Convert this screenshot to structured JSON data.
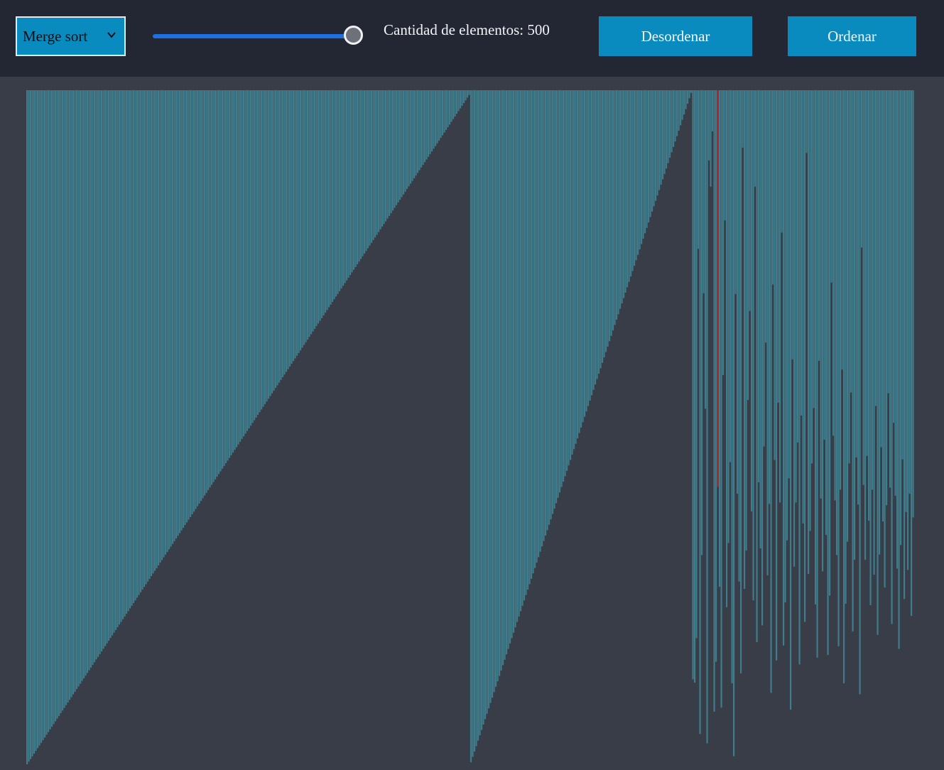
{
  "toolbar": {
    "algorithm_select": {
      "selected": "Merge sort",
      "icon": "chevron-down-icon"
    },
    "size_slider": {
      "value": 500,
      "fill_fraction": 1.0
    },
    "count_label": "Cantidad de elementos: 500",
    "shuffle_button_label": "Desordenar",
    "sort_button_label": "Ordenar"
  },
  "colors": {
    "toolbar_bg": "#222733",
    "canvas_bg": "#393d47",
    "button_bg": "#0a8bbf",
    "bar": "#3f7d8c",
    "bar_highlight": "#b3262c",
    "slider_track": "#1e6fe0"
  },
  "visualization": {
    "element_count": 500,
    "value_range": [
      0,
      1
    ],
    "sorted_runs": [
      {
        "count": 250,
        "from": 0.999,
        "to": 0.007
      },
      {
        "count": 125,
        "from": 0.996,
        "to": 0.004
      }
    ],
    "unsorted_tail_values": [
      0.873,
      0.878,
      0.812,
      0.235,
      0.954,
      0.689,
      0.301,
      0.472,
      0.968,
      0.104,
      0.143,
      0.061,
      0.921,
      0.847,
      0.588,
      0.736,
      0.915,
      0.422,
      0.193,
      0.766,
      0.671,
      0.551,
      0.879,
      0.987,
      0.302,
      0.598,
      0.728,
      0.864,
      0.085,
      0.739,
      0.682,
      0.459,
      0.327,
      0.624,
      0.756,
      0.143,
      0.818,
      0.581,
      0.679,
      0.793,
      0.528,
      0.374,
      0.719,
      0.613,
      0.893,
      0.288,
      0.548,
      0.845,
      0.463,
      0.611,
      0.211,
      0.823,
      0.759,
      0.667,
      0.575,
      0.918,
      0.399,
      0.706,
      0.611,
      0.522,
      0.851,
      0.482,
      0.642,
      0.788,
      0.093,
      0.717,
      0.653,
      0.553,
      0.471,
      0.762,
      0.841,
      0.401,
      0.605,
      0.713,
      0.518,
      0.659,
      0.837,
      0.749,
      0.285,
      0.512,
      0.608,
      0.689,
      0.824,
      0.592,
      0.414,
      0.879,
      0.761,
      0.669,
      0.553,
      0.448,
      0.802,
      0.696,
      0.544,
      0.614,
      0.895,
      0.233,
      0.585,
      0.696,
      0.542,
      0.638,
      0.763,
      0.592,
      0.718,
      0.468,
      0.807,
      0.688,
      0.529,
      0.639,
      0.737,
      0.615,
      0.449,
      0.589,
      0.791,
      0.493,
      0.601,
      0.709,
      0.828,
      0.674,
      0.547,
      0.754,
      0.625,
      0.711,
      0.598,
      0.779,
      0.633
    ],
    "highlighted_index": 389
  }
}
